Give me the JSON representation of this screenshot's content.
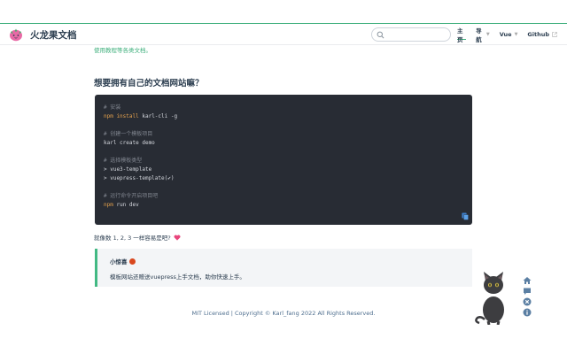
{
  "header": {
    "site_title": "火龙果文档",
    "search": {
      "value": "",
      "placeholder": ""
    },
    "nav": [
      {
        "label": "主页",
        "active": true
      },
      {
        "label": "导航",
        "dropdown": true
      },
      {
        "label": "Vue",
        "dropdown": true
      },
      {
        "label": "Github",
        "external": true
      }
    ]
  },
  "main": {
    "intro": "使用教程等各类文档。",
    "heading": "想要拥有自己的文档网站嘛？",
    "code": [
      {
        "type": "comment",
        "text": "# 安装"
      },
      {
        "type": "cmd",
        "kw": "npm install",
        "rest": " karl-cli -g"
      },
      {
        "type": "blank",
        "text": ""
      },
      {
        "type": "comment",
        "text": "# 创建一个模板项目"
      },
      {
        "type": "plain",
        "text": "karl create demo"
      },
      {
        "type": "blank",
        "text": ""
      },
      {
        "type": "comment",
        "text": "# 选择模板类型"
      },
      {
        "type": "plain",
        "text": "> vue3-template"
      },
      {
        "type": "plain",
        "text": "> vuepress-template(✔)"
      },
      {
        "type": "blank",
        "text": ""
      },
      {
        "type": "comment",
        "text": "# 运行命令开启项目吧"
      },
      {
        "type": "cmd",
        "kw": "npm",
        "rest": " run dev"
      }
    ],
    "easy_text": "就像数 1, 2, 3 一样容易是吧?",
    "tip": {
      "title": "小惊喜",
      "text": "模板网站还赠送vuepress上手文档，助你快速上手。"
    }
  },
  "footer": {
    "text": "MIT Licensed | Copyright © Karl_fang 2022 All Rights Reserved."
  },
  "side_tools": [
    "home-icon",
    "chat-icon",
    "close-icon",
    "info-icon"
  ],
  "colors": {
    "accent": "#3eaf7c",
    "code_bg": "#282c34",
    "tip_border": "#42b983",
    "tool_blue": "#5b7fa3"
  }
}
